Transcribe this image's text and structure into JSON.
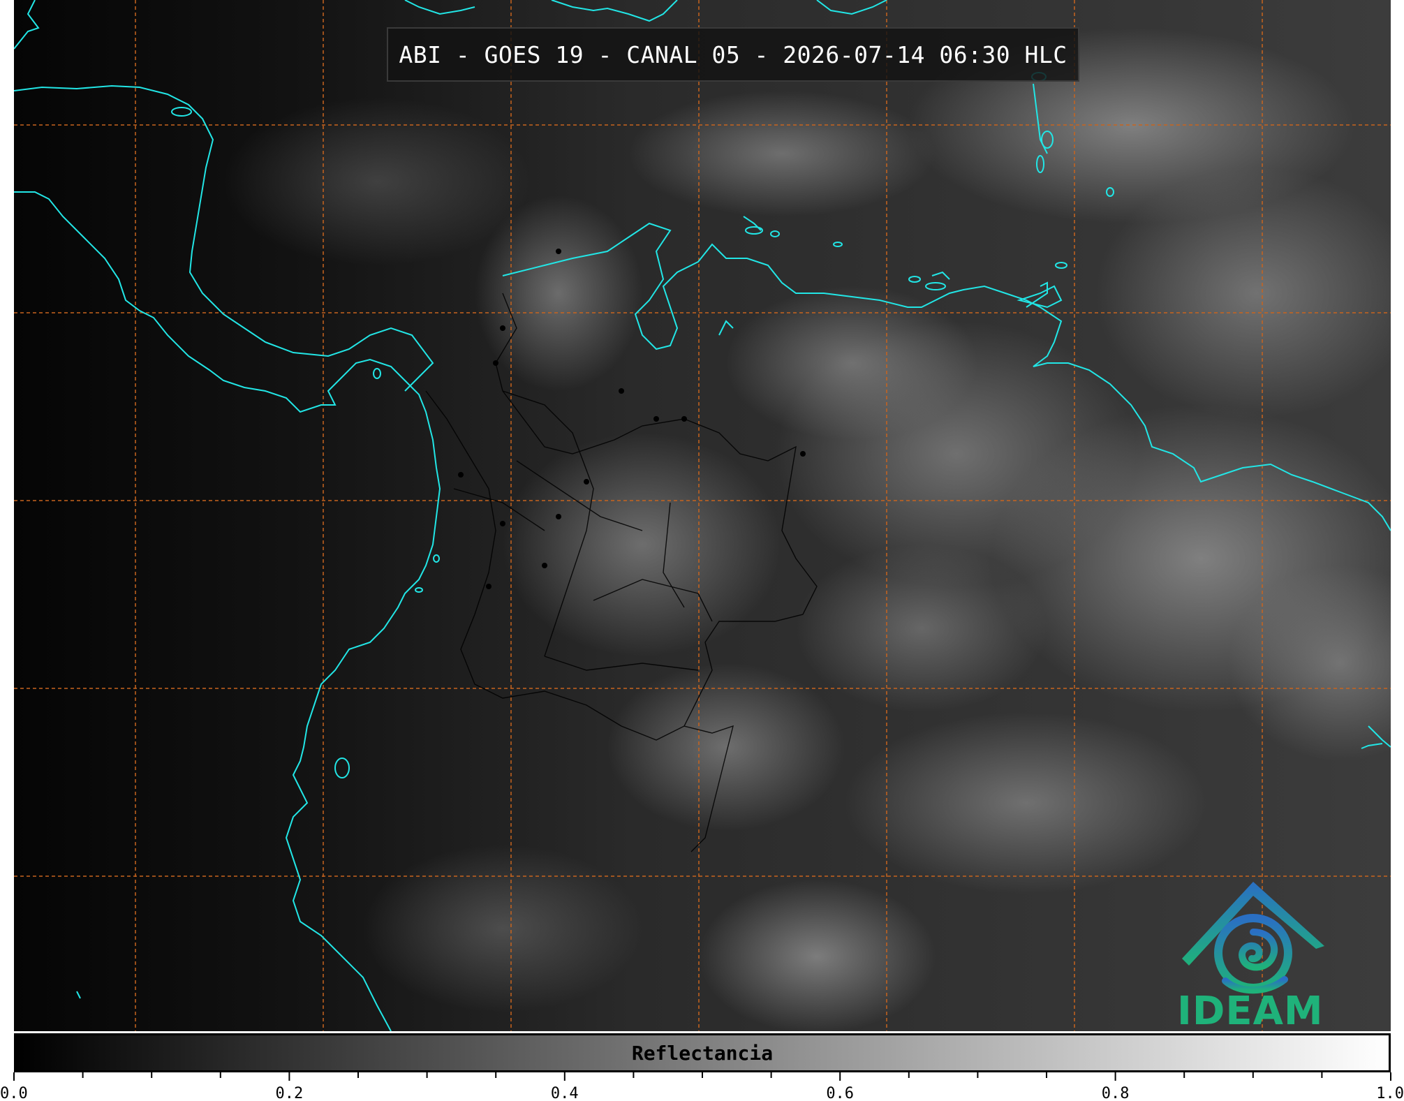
{
  "map": {
    "title": "ABI - GOES 19 - CANAL 05 - 2026-07-14 06:30 HLC",
    "logo_text": "IDEAM",
    "logo_icon": "ideam-logo-icon",
    "colors": {
      "coastline": "#22e6e6",
      "gridline": "#c8641e",
      "borders": "#000000",
      "logo_green": "#1fb27a",
      "logo_blue": "#2a6fc4"
    }
  },
  "colorbar": {
    "label": "Reflectancia",
    "min": 0.0,
    "max": 1.0,
    "tick_labels": [
      "0.0",
      "0.2",
      "0.4",
      "0.6",
      "0.8",
      "1.0"
    ],
    "tick_values": [
      0.0,
      0.2,
      0.4,
      0.6,
      0.8,
      1.0
    ],
    "minor_step": 0.05
  }
}
